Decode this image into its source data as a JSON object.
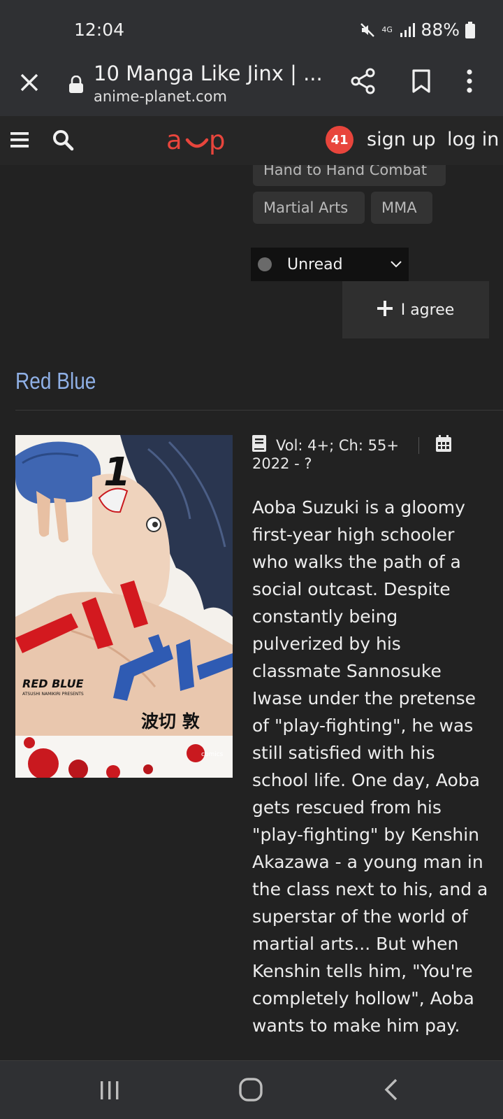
{
  "status_bar": {
    "time": "12:04",
    "network": "4G",
    "battery": "88%"
  },
  "browser": {
    "title": "10 Manga Like Jinx | ...",
    "url": "anime-planet.com"
  },
  "header": {
    "logo_text": "a‿p",
    "notification_count": "41",
    "signup_label": "sign up",
    "login_label": "log in"
  },
  "tags": [
    "Hand to Hand Combat",
    "Martial Arts",
    "MMA"
  ],
  "status_select": {
    "value": "Unread"
  },
  "agree_button": {
    "label": "I agree"
  },
  "entry": {
    "title": "Red Blue",
    "volumes_chapters": "Vol: 4+; Ch: 55+",
    "years": "2022 - ?",
    "synopsis": "Aoba Suzuki is a gloomy first-year high schooler who walks the path of a social outcast. Despite constantly being pulverized by his classmate Sannosuke Iwase under the pretense of \"play-fighting\", he was still satisfied with his school life. One day, Aoba gets rescued from his \"play-fighting\" by Kenshin Akazawa - a young man in the class next to his, and a superstar of the world of martial arts... But when Kenshin tells him, \"You're completely hollow\", Aoba wants to make him pay.",
    "cover": {
      "volume_number": "1",
      "english_title": "RED BLUE",
      "author_line": "ATSUSHI NAMIKIRI PRESENTS",
      "author_jp": "波切 敦",
      "publisher": "comics"
    }
  },
  "colors": {
    "accent": "#e8453c",
    "section_title": "#8fb0e6",
    "background": "#222222"
  }
}
